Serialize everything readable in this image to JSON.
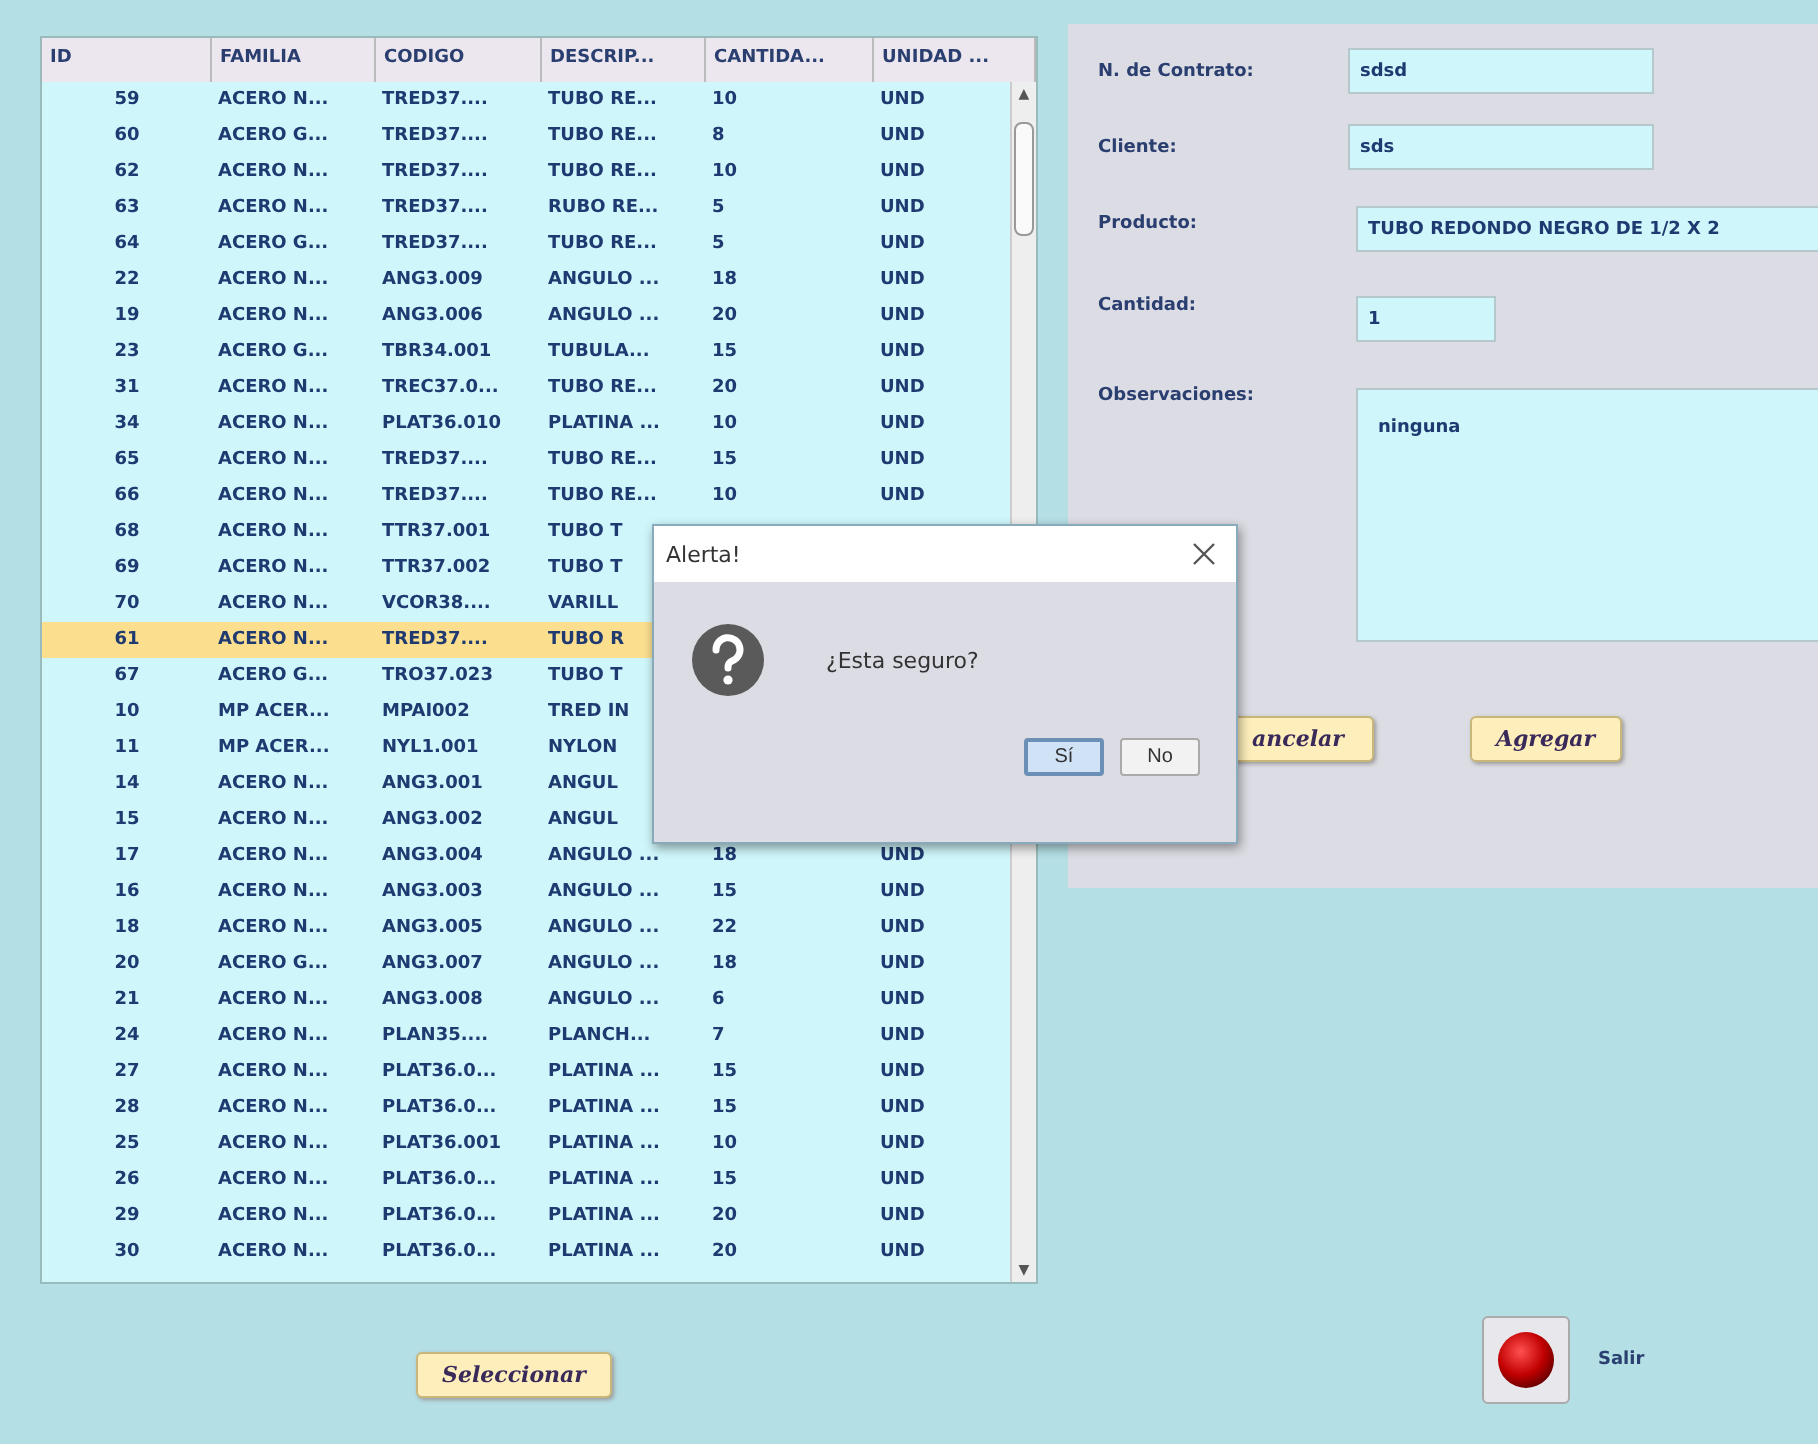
{
  "table": {
    "columns": [
      "ID",
      "FAMILIA",
      "CODIGO",
      "DESCRIP...",
      "CANTIDA...",
      "UNIDAD ..."
    ],
    "rows": [
      {
        "cells": [
          "59",
          "ACERO N...",
          "TRED37....",
          "TUBO RE...",
          "10",
          "UND"
        ],
        "selected": false
      },
      {
        "cells": [
          "60",
          "ACERO G...",
          "TRED37....",
          "TUBO RE...",
          "8",
          "UND"
        ],
        "selected": false
      },
      {
        "cells": [
          "62",
          "ACERO N...",
          "TRED37....",
          "TUBO RE...",
          "10",
          "UND"
        ],
        "selected": false
      },
      {
        "cells": [
          "63",
          "ACERO N...",
          "TRED37....",
          "RUBO RE...",
          "5",
          "UND"
        ],
        "selected": false
      },
      {
        "cells": [
          "64",
          "ACERO G...",
          "TRED37....",
          "TUBO RE...",
          "5",
          "UND"
        ],
        "selected": false
      },
      {
        "cells": [
          "22",
          "ACERO N...",
          "ANG3.009",
          "ANGULO ...",
          "18",
          "UND"
        ],
        "selected": false
      },
      {
        "cells": [
          "19",
          "ACERO N...",
          "ANG3.006",
          "ANGULO ...",
          "20",
          "UND"
        ],
        "selected": false
      },
      {
        "cells": [
          "23",
          "ACERO G...",
          "TBR34.001",
          "TUBULA...",
          "15",
          "UND"
        ],
        "selected": false
      },
      {
        "cells": [
          "31",
          "ACERO N...",
          "TREC37.0...",
          "TUBO RE...",
          "20",
          "UND"
        ],
        "selected": false
      },
      {
        "cells": [
          "34",
          "ACERO N...",
          "PLAT36.010",
          "PLATINA ...",
          "10",
          "UND"
        ],
        "selected": false
      },
      {
        "cells": [
          "65",
          "ACERO N...",
          "TRED37....",
          "TUBO RE...",
          "15",
          "UND"
        ],
        "selected": false
      },
      {
        "cells": [
          "66",
          "ACERO N...",
          "TRED37....",
          "TUBO RE...",
          "10",
          "UND"
        ],
        "selected": false
      },
      {
        "cells": [
          "68",
          "ACERO N...",
          "TTR37.001",
          "TUBO T"
        ],
        "selected": false
      },
      {
        "cells": [
          "69",
          "ACERO N...",
          "TTR37.002",
          "TUBO T"
        ],
        "selected": false
      },
      {
        "cells": [
          "70",
          "ACERO N...",
          "VCOR38....",
          "VARILL"
        ],
        "selected": false
      },
      {
        "cells": [
          "61",
          "ACERO N...",
          "TRED37....",
          "TUBO R"
        ],
        "selected": true
      },
      {
        "cells": [
          "67",
          "ACERO G...",
          "TRO37.023",
          "TUBO T"
        ],
        "selected": false
      },
      {
        "cells": [
          "10",
          "MP ACER...",
          "MPAI002",
          "TRED IN"
        ],
        "selected": false
      },
      {
        "cells": [
          "11",
          "MP ACER...",
          "NYL1.001",
          "NYLON"
        ],
        "selected": false
      },
      {
        "cells": [
          "14",
          "ACERO N...",
          "ANG3.001",
          "ANGUL"
        ],
        "selected": false
      },
      {
        "cells": [
          "15",
          "ACERO N...",
          "ANG3.002",
          "ANGUL"
        ],
        "selected": false
      },
      {
        "cells": [
          "17",
          "ACERO N...",
          "ANG3.004",
          "ANGULO ...",
          "18",
          "UND"
        ],
        "selected": false
      },
      {
        "cells": [
          "16",
          "ACERO N...",
          "ANG3.003",
          "ANGULO ...",
          "15",
          "UND"
        ],
        "selected": false
      },
      {
        "cells": [
          "18",
          "ACERO N...",
          "ANG3.005",
          "ANGULO ...",
          "22",
          "UND"
        ],
        "selected": false
      },
      {
        "cells": [
          "20",
          "ACERO G...",
          "ANG3.007",
          "ANGULO ...",
          "18",
          "UND"
        ],
        "selected": false
      },
      {
        "cells": [
          "21",
          "ACERO N...",
          "ANG3.008",
          "ANGULO ...",
          "6",
          "UND"
        ],
        "selected": false
      },
      {
        "cells": [
          "24",
          "ACERO N...",
          "PLAN35....",
          "PLANCH...",
          "7",
          "UND"
        ],
        "selected": false
      },
      {
        "cells": [
          "27",
          "ACERO N...",
          "PLAT36.0...",
          "PLATINA ...",
          "15",
          "UND"
        ],
        "selected": false
      },
      {
        "cells": [
          "28",
          "ACERO N...",
          "PLAT36.0...",
          "PLATINA ...",
          "15",
          "UND"
        ],
        "selected": false
      },
      {
        "cells": [
          "25",
          "ACERO N...",
          "PLAT36.001",
          "PLATINA ...",
          "10",
          "UND"
        ],
        "selected": false
      },
      {
        "cells": [
          "26",
          "ACERO N...",
          "PLAT36.0...",
          "PLATINA ...",
          "15",
          "UND"
        ],
        "selected": false
      },
      {
        "cells": [
          "29",
          "ACERO N...",
          "PLAT36.0...",
          "PLATINA ...",
          "20",
          "UND"
        ],
        "selected": false
      },
      {
        "cells": [
          "30",
          "ACERO N...",
          "PLAT36.0...",
          "PLATINA ...",
          "20",
          "UND"
        ],
        "selected": false
      }
    ]
  },
  "select_button": "Seleccionar",
  "form": {
    "fields": [
      {
        "label": "N. de Contrato:",
        "value": "sdsd",
        "kind": "short"
      },
      {
        "label": "Cliente:",
        "value": "sds",
        "kind": "short"
      },
      {
        "label": "Producto:",
        "value": "TUBO REDONDO NEGRO DE 1/2 X 2",
        "kind": "wide"
      },
      {
        "label": "Cantidad:",
        "value": "1",
        "kind": "tiny"
      },
      {
        "label": "Observaciones:",
        "value": "ninguna",
        "kind": "area"
      }
    ],
    "buttons": [
      "ancelar",
      "Agregar"
    ]
  },
  "scrollbar": {
    "up": "▲",
    "down": "▼"
  },
  "exit_button": {
    "label": "Salir"
  },
  "dialog": {
    "title": "Alerta!",
    "message": "¿Esta seguro?",
    "buttons": [
      {
        "label": "Sí",
        "selected": true
      },
      {
        "label": "No",
        "selected": false
      }
    ]
  }
}
